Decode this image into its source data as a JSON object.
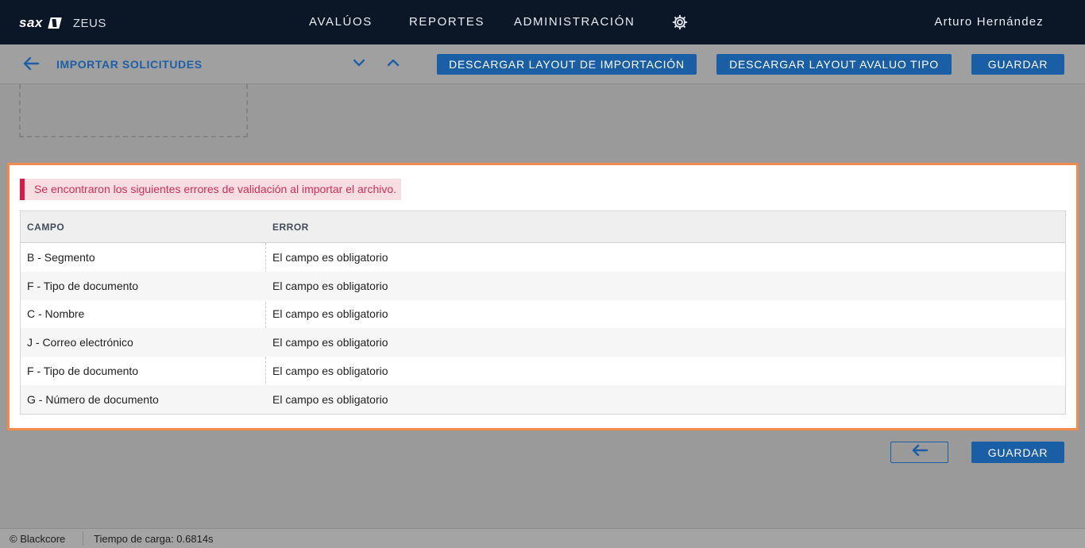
{
  "header": {
    "logo_text": "sax",
    "product": "ZEUS",
    "nav": [
      "AVALÚOS",
      "REPORTES",
      "ADMINISTRACIÓN"
    ],
    "settings_icon": "gear-icon",
    "user": "Arturo Hernández"
  },
  "toolbar": {
    "title": "IMPORTAR SOLICITUDES",
    "buttons": {
      "download_import_layout": "DESCARGAR LAYOUT DE IMPORTACIÓN",
      "download_appraisal_layout": "DESCARGAR LAYOUT AVALUO TIPO",
      "save": "GUARDAR"
    }
  },
  "errors": {
    "message": "Se encontraron los siguientes errores de validación al importar el archivo.",
    "columns": [
      "CAMPO",
      "ERROR"
    ],
    "rows": [
      {
        "campo": "B - Segmento",
        "error": "El campo es obligatorio"
      },
      {
        "campo": "F - Tipo de documento",
        "error": "El campo es obligatorio"
      },
      {
        "campo": "C - Nombre",
        "error": "El campo es obligatorio"
      },
      {
        "campo": "J - Correo electrónico",
        "error": "El campo es obligatorio"
      },
      {
        "campo": "F - Tipo de documento",
        "error": "El campo es obligatorio"
      },
      {
        "campo": "G - Número de documento",
        "error": "El campo es obligatorio"
      }
    ]
  },
  "actions": {
    "save": "GUARDAR"
  },
  "footer": {
    "copyright": "© Blackcore",
    "load_time": "Tiempo de carga: 0.6814s"
  },
  "colors": {
    "primary": "#1a5fa6",
    "topbar": "#0b1626",
    "error_text": "#d32f57",
    "panel_highlight": "#f28a4b"
  }
}
